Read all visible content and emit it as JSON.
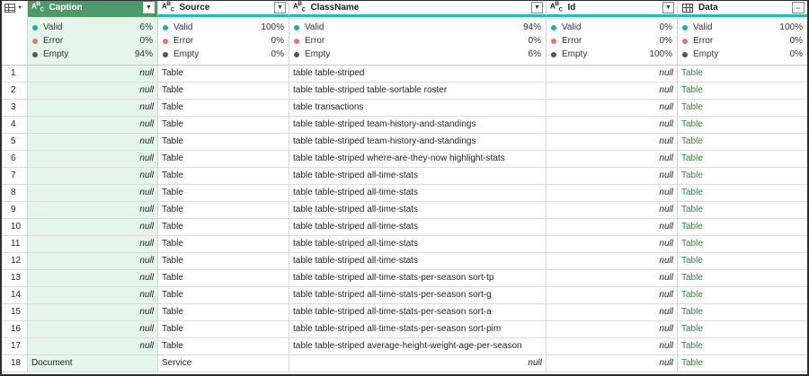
{
  "columns": [
    {
      "name": "Caption",
      "type_icon": "ABC",
      "dropdown_icon": "chevron-down-icon"
    },
    {
      "name": "Source",
      "type_icon": "ABC",
      "dropdown_icon": "chevron-down-icon"
    },
    {
      "name": "ClassName",
      "type_icon": "ABC",
      "dropdown_icon": "chevron-down-icon"
    },
    {
      "name": "Id",
      "type_icon": "ABC",
      "dropdown_icon": "chevron-down-icon"
    },
    {
      "name": "Data",
      "type_icon": "table-icon",
      "dropdown_icon": "expand-icon"
    }
  ],
  "profile_labels": {
    "valid": "Valid",
    "error": "Error",
    "empty": "Empty"
  },
  "profile_colors": {
    "valid": "#19b0a4",
    "error": "#e8736c",
    "empty": "#555555"
  },
  "profile": [
    {
      "valid": "6%",
      "error": "0%",
      "empty": "94%"
    },
    {
      "valid": "100%",
      "error": "0%",
      "empty": "0%"
    },
    {
      "valid": "94%",
      "error": "0%",
      "empty": "6%"
    },
    {
      "valid": "0%",
      "error": "0%",
      "empty": "100%"
    },
    {
      "valid": "100%",
      "error": "0%",
      "empty": "0%"
    }
  ],
  "rows": [
    {
      "n": "1",
      "caption": "null",
      "source": "Table",
      "classname": "table table-striped",
      "id": "null",
      "data": "Table"
    },
    {
      "n": "2",
      "caption": "null",
      "source": "Table",
      "classname": "table table-striped table-sortable roster",
      "id": "null",
      "data": "Table"
    },
    {
      "n": "3",
      "caption": "null",
      "source": "Table",
      "classname": "table  transactions",
      "id": "null",
      "data": "Table"
    },
    {
      "n": "4",
      "caption": "null",
      "source": "Table",
      "classname": "table table-striped team-history-and-standings",
      "id": "null",
      "data": "Table"
    },
    {
      "n": "5",
      "caption": "null",
      "source": "Table",
      "classname": "table table-striped team-history-and-standings",
      "id": "null",
      "data": "Table"
    },
    {
      "n": "6",
      "caption": "null",
      "source": "Table",
      "classname": "table table-striped where-are-they-now highlight-stats",
      "id": "null",
      "data": "Table"
    },
    {
      "n": "7",
      "caption": "null",
      "source": "Table",
      "classname": "table table-striped all-time-stats",
      "id": "null",
      "data": "Table"
    },
    {
      "n": "8",
      "caption": "null",
      "source": "Table",
      "classname": "table table-striped all-time-stats",
      "id": "null",
      "data": "Table"
    },
    {
      "n": "9",
      "caption": "null",
      "source": "Table",
      "classname": "table table-striped all-time-stats",
      "id": "null",
      "data": "Table"
    },
    {
      "n": "10",
      "caption": "null",
      "source": "Table",
      "classname": "table table-striped all-time-stats",
      "id": "null",
      "data": "Table"
    },
    {
      "n": "11",
      "caption": "null",
      "source": "Table",
      "classname": "table table-striped all-time-stats",
      "id": "null",
      "data": "Table"
    },
    {
      "n": "12",
      "caption": "null",
      "source": "Table",
      "classname": "table table-striped all-time-stats",
      "id": "null",
      "data": "Table"
    },
    {
      "n": "13",
      "caption": "null",
      "source": "Table",
      "classname": "table table-striped all-time-stats-per-season sort-tp",
      "id": "null",
      "data": "Table"
    },
    {
      "n": "14",
      "caption": "null",
      "source": "Table",
      "classname": "table table-striped all-time-stats-per-season sort-g",
      "id": "null",
      "data": "Table"
    },
    {
      "n": "15",
      "caption": "null",
      "source": "Table",
      "classname": "table table-striped all-time-stats-per-season sort-a",
      "id": "null",
      "data": "Table"
    },
    {
      "n": "16",
      "caption": "null",
      "source": "Table",
      "classname": "table table-striped all-time-stats-per-season sort-pim",
      "id": "null",
      "data": "Table"
    },
    {
      "n": "17",
      "caption": "null",
      "source": "Table",
      "classname": "table table-striped average-height-weight-age-per-season",
      "id": "null",
      "data": "Table"
    },
    {
      "n": "18",
      "caption": "Document",
      "source": "Service",
      "classname": "null",
      "id": "null",
      "data": "Table"
    }
  ]
}
